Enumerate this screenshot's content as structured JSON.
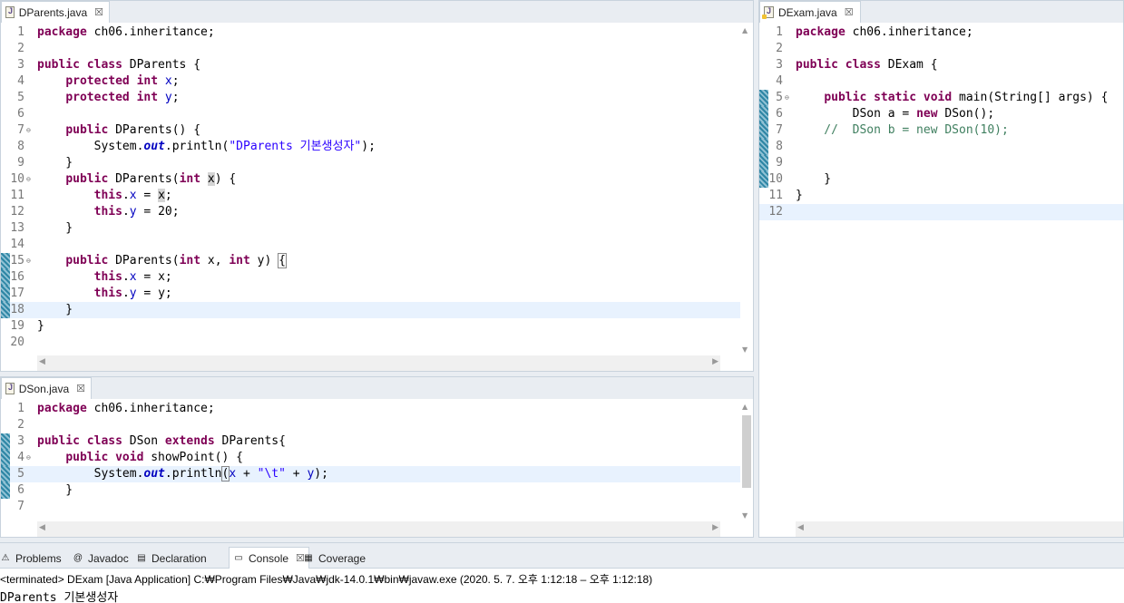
{
  "editors": {
    "dparents": {
      "tab_label": "DParents.java",
      "lines": [
        {
          "n": "1",
          "fold": "",
          "bar": false,
          "cur": false,
          "tokens": [
            {
              "c": "k",
              "t": "package"
            },
            {
              "c": "",
              "t": " ch06.inheritance;"
            }
          ]
        },
        {
          "n": "2",
          "fold": "",
          "bar": false,
          "cur": false,
          "tokens": []
        },
        {
          "n": "3",
          "fold": "",
          "bar": false,
          "cur": false,
          "tokens": [
            {
              "c": "k",
              "t": "public class"
            },
            {
              "c": "",
              "t": " DParents {"
            }
          ]
        },
        {
          "n": "4",
          "fold": "",
          "bar": false,
          "cur": false,
          "tokens": [
            {
              "c": "",
              "t": "    "
            },
            {
              "c": "k",
              "t": "protected int"
            },
            {
              "c": "",
              "t": " "
            },
            {
              "c": "f",
              "t": "x"
            },
            {
              "c": "",
              "t": ";"
            }
          ]
        },
        {
          "n": "5",
          "fold": "",
          "bar": false,
          "cur": false,
          "tokens": [
            {
              "c": "",
              "t": "    "
            },
            {
              "c": "k",
              "t": "protected int"
            },
            {
              "c": "",
              "t": " "
            },
            {
              "c": "f",
              "t": "y"
            },
            {
              "c": "",
              "t": ";"
            }
          ]
        },
        {
          "n": "6",
          "fold": "",
          "bar": false,
          "cur": false,
          "tokens": []
        },
        {
          "n": "7",
          "fold": "⊖",
          "bar": false,
          "cur": false,
          "tokens": [
            {
              "c": "",
              "t": "    "
            },
            {
              "c": "k",
              "t": "public"
            },
            {
              "c": "",
              "t": " DParents() {"
            }
          ]
        },
        {
          "n": "8",
          "fold": "",
          "bar": false,
          "cur": false,
          "tokens": [
            {
              "c": "",
              "t": "        System."
            },
            {
              "c": "fi",
              "t": "out"
            },
            {
              "c": "",
              "t": ".println("
            },
            {
              "c": "s",
              "t": "\"DParents 기본생성자\""
            },
            {
              "c": "",
              "t": ");"
            }
          ]
        },
        {
          "n": "9",
          "fold": "",
          "bar": false,
          "cur": false,
          "tokens": [
            {
              "c": "",
              "t": "    }"
            }
          ]
        },
        {
          "n": "10",
          "fold": "⊖",
          "bar": false,
          "cur": false,
          "tokens": [
            {
              "c": "",
              "t": "    "
            },
            {
              "c": "k",
              "t": "public"
            },
            {
              "c": "",
              "t": " DParents("
            },
            {
              "c": "k",
              "t": "int"
            },
            {
              "c": "",
              "t": " "
            },
            {
              "c": "hl",
              "t": "x"
            },
            {
              "c": "",
              "t": ") {"
            }
          ]
        },
        {
          "n": "11",
          "fold": "",
          "bar": false,
          "cur": false,
          "tokens": [
            {
              "c": "",
              "t": "        "
            },
            {
              "c": "k",
              "t": "this"
            },
            {
              "c": "",
              "t": "."
            },
            {
              "c": "f",
              "t": "x"
            },
            {
              "c": "",
              "t": " = "
            },
            {
              "c": "hl",
              "t": "x"
            },
            {
              "c": "",
              "t": ";"
            }
          ]
        },
        {
          "n": "12",
          "fold": "",
          "bar": false,
          "cur": false,
          "tokens": [
            {
              "c": "",
              "t": "        "
            },
            {
              "c": "k",
              "t": "this"
            },
            {
              "c": "",
              "t": "."
            },
            {
              "c": "f",
              "t": "y"
            },
            {
              "c": "",
              "t": " = 20;"
            }
          ]
        },
        {
          "n": "13",
          "fold": "",
          "bar": false,
          "cur": false,
          "tokens": [
            {
              "c": "",
              "t": "    }"
            }
          ]
        },
        {
          "n": "14",
          "fold": "",
          "bar": false,
          "cur": false,
          "tokens": []
        },
        {
          "n": "15",
          "fold": "⊖",
          "bar": true,
          "cur": false,
          "tokens": [
            {
              "c": "",
              "t": "    "
            },
            {
              "c": "k",
              "t": "public"
            },
            {
              "c": "",
              "t": " DParents("
            },
            {
              "c": "k",
              "t": "int"
            },
            {
              "c": "",
              "t": " x, "
            },
            {
              "c": "k",
              "t": "int"
            },
            {
              "c": "",
              "t": " y) "
            },
            {
              "c": "brk",
              "t": "{"
            }
          ]
        },
        {
          "n": "16",
          "fold": "",
          "bar": true,
          "cur": false,
          "tokens": [
            {
              "c": "",
              "t": "        "
            },
            {
              "c": "k",
              "t": "this"
            },
            {
              "c": "",
              "t": "."
            },
            {
              "c": "f",
              "t": "x"
            },
            {
              "c": "",
              "t": " = x;"
            }
          ]
        },
        {
          "n": "17",
          "fold": "",
          "bar": true,
          "cur": false,
          "tokens": [
            {
              "c": "",
              "t": "        "
            },
            {
              "c": "k",
              "t": "this"
            },
            {
              "c": "",
              "t": "."
            },
            {
              "c": "f",
              "t": "y"
            },
            {
              "c": "",
              "t": " = y;"
            }
          ]
        },
        {
          "n": "18",
          "fold": "",
          "bar": true,
          "cur": true,
          "tokens": [
            {
              "c": "",
              "t": "    }"
            }
          ]
        },
        {
          "n": "19",
          "fold": "",
          "bar": false,
          "cur": false,
          "tokens": [
            {
              "c": "",
              "t": "}"
            }
          ]
        },
        {
          "n": "20",
          "fold": "",
          "bar": false,
          "cur": false,
          "tokens": []
        }
      ]
    },
    "dson": {
      "tab_label": "DSon.java",
      "lines": [
        {
          "n": "1",
          "fold": "",
          "bar": false,
          "cur": false,
          "tokens": [
            {
              "c": "k",
              "t": "package"
            },
            {
              "c": "",
              "t": " ch06.inheritance;"
            }
          ]
        },
        {
          "n": "2",
          "fold": "",
          "bar": false,
          "cur": false,
          "tokens": []
        },
        {
          "n": "3",
          "fold": "",
          "bar": true,
          "cur": false,
          "tokens": [
            {
              "c": "k",
              "t": "public class"
            },
            {
              "c": "",
              "t": " DSon "
            },
            {
              "c": "k",
              "t": "extends"
            },
            {
              "c": "",
              "t": " DParents{"
            }
          ]
        },
        {
          "n": "4",
          "fold": "⊖",
          "bar": true,
          "cur": false,
          "tokens": [
            {
              "c": "",
              "t": "    "
            },
            {
              "c": "k",
              "t": "public void"
            },
            {
              "c": "",
              "t": " showPoint() {"
            }
          ]
        },
        {
          "n": "5",
          "fold": "",
          "bar": true,
          "cur": true,
          "tokens": [
            {
              "c": "",
              "t": "        System."
            },
            {
              "c": "fi",
              "t": "out"
            },
            {
              "c": "",
              "t": ".println"
            },
            {
              "c": "brk",
              "t": "("
            },
            {
              "c": "f",
              "t": "x"
            },
            {
              "c": "",
              "t": " + "
            },
            {
              "c": "s",
              "t": "\"\\t\""
            },
            {
              "c": "",
              "t": " + "
            },
            {
              "c": "f",
              "t": "y"
            },
            {
              "c": "",
              "t": ");"
            }
          ]
        },
        {
          "n": "6",
          "fold": "",
          "bar": true,
          "cur": false,
          "tokens": [
            {
              "c": "",
              "t": "    }"
            }
          ]
        },
        {
          "n": "7",
          "fold": "",
          "bar": false,
          "cur": false,
          "tokens": []
        }
      ]
    },
    "dexam": {
      "tab_label": "DExam.java",
      "lines": [
        {
          "n": "1",
          "fold": "",
          "bar": false,
          "cur": false,
          "tokens": [
            {
              "c": "k",
              "t": "package"
            },
            {
              "c": "",
              "t": " ch06.inheritance;"
            }
          ]
        },
        {
          "n": "2",
          "fold": "",
          "bar": false,
          "cur": false,
          "tokens": []
        },
        {
          "n": "3",
          "fold": "",
          "bar": false,
          "cur": false,
          "tokens": [
            {
              "c": "k",
              "t": "public class"
            },
            {
              "c": "",
              "t": " DExam {"
            }
          ]
        },
        {
          "n": "4",
          "fold": "",
          "bar": false,
          "cur": false,
          "tokens": []
        },
        {
          "n": "5",
          "fold": "⊖",
          "bar": true,
          "cur": false,
          "tokens": [
            {
              "c": "",
              "t": "    "
            },
            {
              "c": "k",
              "t": "public static void"
            },
            {
              "c": "",
              "t": " main(String[] args) {"
            }
          ]
        },
        {
          "n": "6",
          "fold": "",
          "bar": true,
          "cur": false,
          "tokens": [
            {
              "c": "",
              "t": "        DSon "
            },
            {
              "c": "",
              "t": "a"
            },
            {
              "c": "",
              "t": " = "
            },
            {
              "c": "k",
              "t": "new"
            },
            {
              "c": "",
              "t": " DSon();"
            }
          ]
        },
        {
          "n": "7",
          "fold": "",
          "bar": true,
          "cur": false,
          "tokens": [
            {
              "c": "cm",
              "t": "    //  DSon b = new DSon(10);"
            }
          ]
        },
        {
          "n": "8",
          "fold": "",
          "bar": true,
          "cur": false,
          "tokens": []
        },
        {
          "n": "9",
          "fold": "",
          "bar": true,
          "cur": false,
          "tokens": []
        },
        {
          "n": "10",
          "fold": "",
          "bar": true,
          "cur": false,
          "tokens": [
            {
              "c": "",
              "t": "    }"
            }
          ]
        },
        {
          "n": "11",
          "fold": "",
          "bar": false,
          "cur": false,
          "tokens": [
            {
              "c": "",
              "t": "}"
            }
          ]
        },
        {
          "n": "12",
          "fold": "",
          "bar": false,
          "cur": true,
          "tokens": []
        }
      ]
    }
  },
  "bottom_tabs": [
    {
      "label": "Problems",
      "icon": "problems-icon",
      "glyph": "⚠",
      "active": false
    },
    {
      "label": "Javadoc",
      "icon": "javadoc-icon",
      "glyph": "@",
      "active": false
    },
    {
      "label": "Declaration",
      "icon": "declaration-icon",
      "glyph": "▤",
      "active": false
    },
    {
      "label": "Console",
      "icon": "console-icon",
      "glyph": "▭",
      "active": true
    },
    {
      "label": "Coverage",
      "icon": "coverage-icon",
      "glyph": "▦",
      "active": false
    }
  ],
  "console": {
    "status": "<terminated> DExam [Java Application] C:₩Program Files₩Java₩jdk-14.0.1₩bin₩javaw.exe  (2020. 5. 7. 오후 1:12:18 – 오후 1:12:18)",
    "output": "DParents 기본생성자",
    "close_glyph": "☒"
  }
}
